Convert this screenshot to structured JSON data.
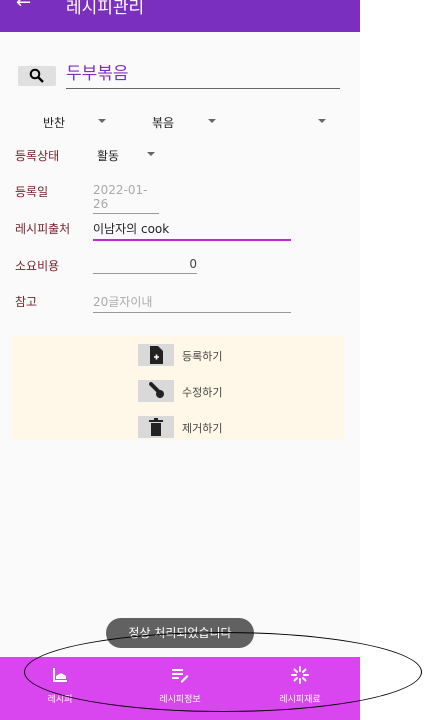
{
  "appbar": {
    "back_icon": "arrow-left-icon",
    "title": "레시피관리"
  },
  "search": {
    "value": "두부볶음",
    "icon": "search-icon"
  },
  "category": {
    "main": "반찬",
    "sub": "볶음",
    "third": ""
  },
  "status": {
    "label": "등록상태",
    "value": "활동"
  },
  "reg_date": {
    "label": "등록일",
    "value": "2022-01-26"
  },
  "source": {
    "label": "레시피출처",
    "value": "이남자의 cook"
  },
  "cost": {
    "label": "소요비용",
    "value": "0"
  },
  "note": {
    "label": "참고",
    "placeholder": "20글자이내"
  },
  "actions": [
    {
      "label": "등록하기",
      "icon": "file-add-icon"
    },
    {
      "label": "수정하기",
      "icon": "wrench-icon"
    },
    {
      "label": "제거하기",
      "icon": "trash-icon"
    }
  ],
  "toast": "정상 처리되었습니다",
  "bottom_nav": [
    {
      "label": "레시피",
      "icon": "recipe-icon"
    },
    {
      "label": "레시피정보",
      "icon": "edit-list-icon"
    },
    {
      "label": "레시피재료",
      "icon": "ingredient-icon"
    }
  ],
  "colors": {
    "primary": "#7b2fbe",
    "bottom_bar": "#d946ef",
    "label": "#7a1f2b",
    "panel": "#fff8e8"
  }
}
